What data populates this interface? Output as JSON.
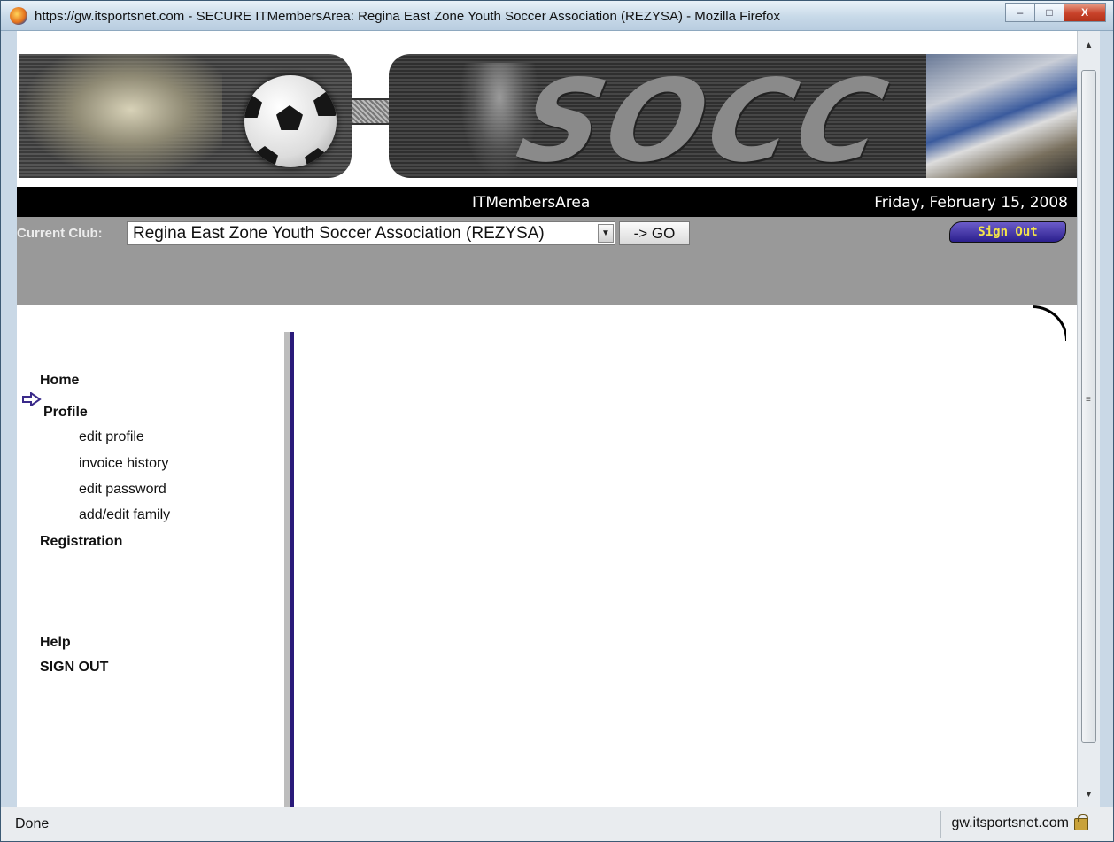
{
  "window": {
    "title": "https://gw.itsportsnet.com - SECURE ITMembersArea: Regina East Zone Youth Soccer Association (REZYSA) - Mozilla Firefox",
    "btn_min": "–",
    "btn_max": "□",
    "btn_close": "X"
  },
  "banner": {
    "text": "SOCC"
  },
  "infobar": {
    "area": "ITMembersArea",
    "date": "Friday, February 15, 2008"
  },
  "club": {
    "label": "Current Club:",
    "selected": "Regina East Zone Youth Soccer Association (REZYSA)",
    "go_label": "-> GO",
    "signout_label": "Sign Out"
  },
  "nav": {
    "home": "Home",
    "profile": "Profile",
    "profile_items": [
      "edit profile",
      "invoice history",
      "edit password",
      "add/edit family"
    ],
    "registration": "Registration",
    "help": "Help",
    "signout": "SIGN OUT"
  },
  "status": {
    "text": "Done",
    "host": "gw.itsportsnet.com"
  },
  "colors": {
    "nav_accent": "#2a1a7a",
    "signout_text": "#f3e44a",
    "clubbar_bg": "#999999"
  }
}
